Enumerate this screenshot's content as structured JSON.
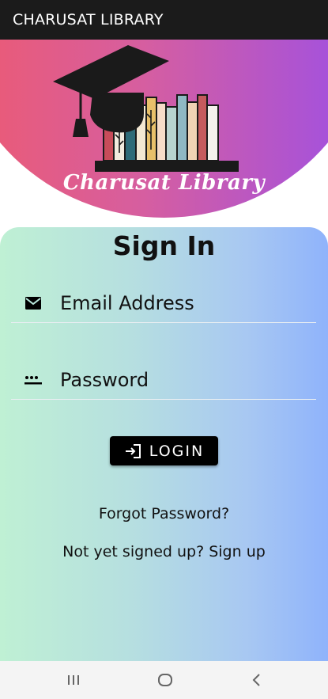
{
  "app_bar": {
    "title": "CHARUSAT LIBRARY"
  },
  "hero": {
    "logo_text": "Charusat Library",
    "icons": [
      "graduation-cap-icon",
      "books-icon"
    ],
    "colors": {
      "gradient_start": "#ee5a6f",
      "gradient_end": "#9b4fe8"
    }
  },
  "form": {
    "title": "Sign In",
    "email": {
      "icon": "email-icon",
      "placeholder": "Email Address",
      "value": ""
    },
    "password": {
      "icon": "password-icon",
      "placeholder": "Password",
      "value": ""
    },
    "login": {
      "icon": "login-icon",
      "label": "LOGIN"
    },
    "forgot_password": "Forgot Password?",
    "signup_prompt": "Not yet signed up? Sign up",
    "colors": {
      "gradient_start": "#bff0d4",
      "gradient_end": "#8fb3fb"
    }
  },
  "nav_bar": {
    "items": [
      "recents-icon",
      "home-icon",
      "back-icon"
    ]
  }
}
